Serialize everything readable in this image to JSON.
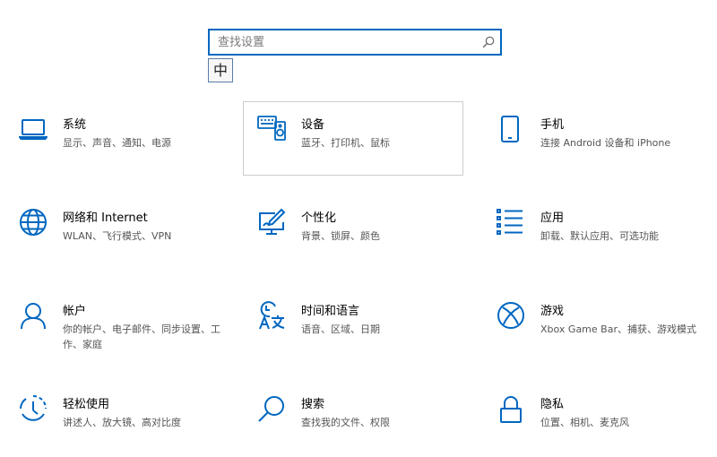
{
  "search": {
    "placeholder": "查找设置"
  },
  "ime": {
    "label": "中"
  },
  "colors": {
    "accent": "#0067c0",
    "title_text": "#000000",
    "description_text": "#555555",
    "selected_border": "#cccccc"
  },
  "tiles": [
    {
      "icon": "laptop-icon",
      "title": "系统",
      "description": "显示、声音、通知、电源"
    },
    {
      "icon": "keyboard-speaker-icon",
      "title": "设备",
      "description": "蓝牙、打印机、鼠标"
    },
    {
      "icon": "phone-icon",
      "title": "手机",
      "description": "连接 Android 设备和 iPhone"
    },
    {
      "icon": "globe-icon",
      "title": "网络和 Internet",
      "description": "WLAN、飞行模式、VPN"
    },
    {
      "icon": "pen-monitor-icon",
      "title": "个性化",
      "description": "背景、锁屏、颜色"
    },
    {
      "icon": "app-list-icon",
      "title": "应用",
      "description": "卸载、默认应用、可选功能"
    },
    {
      "icon": "person-icon",
      "title": "帐户",
      "description": "你的帐户、电子邮件、同步设置、工作、家庭"
    },
    {
      "icon": "time-language-icon",
      "title": "时间和语言",
      "description": "语音、区域、日期"
    },
    {
      "icon": "xbox-icon",
      "title": "游戏",
      "description": "Xbox Game Bar、捕获、游戏模式"
    },
    {
      "icon": "ease-of-access-icon",
      "title": "轻松使用",
      "description": "讲述人、放大镜、高对比度"
    },
    {
      "icon": "search-magnifier-icon",
      "title": "搜索",
      "description": "查找我的文件、权限"
    },
    {
      "icon": "lock-icon",
      "title": "隐私",
      "description": "位置、相机、麦克风"
    }
  ]
}
